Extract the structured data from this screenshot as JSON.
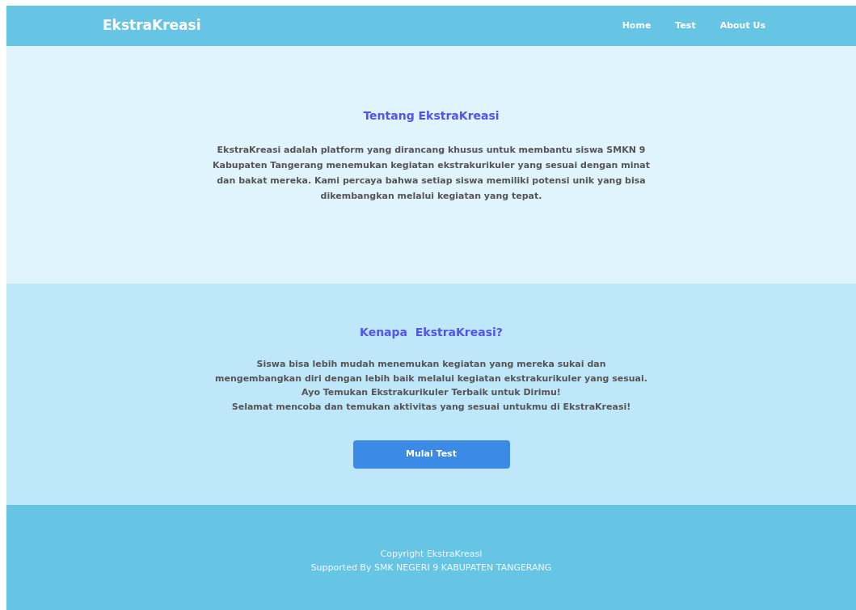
{
  "navbar": {
    "brand": "EkstraKreasi",
    "links": [
      "Home",
      "Test",
      "About Us"
    ]
  },
  "about": {
    "title": "Tentang EkstraKreasi",
    "text": "EkstraKreasi adalah platform yang dirancang khusus untuk membantu siswa SMKN 9 Kabupaten Tangerang menemukan kegiatan ekstrakurikuler yang sesuai dengan minat dan bakat mereka. Kami percaya bahwa setiap siswa memiliki potensi unik yang bisa dikembangkan melalui kegiatan yang tepat."
  },
  "why": {
    "title": "Kenapa  EkstraKreasi?",
    "lines": [
      "Siswa bisa lebih mudah menemukan kegiatan yang mereka sukai dan",
      "mengembangkan diri dengan lebih baik melalui kegiatan ekstrakurikuler yang sesuai.",
      "Ayo Temukan Ekstrakurikuler Terbaik untuk Dirimu!",
      "Selamat mencoba dan temukan aktivitas yang sesuai untukmu di EkstraKreasi!"
    ],
    "button": "Mulai Test"
  },
  "footer": [
    "Copyright EkstraKreasi",
    "Supported By SMK NEGERI 9 KABUPATEN TANGERANG"
  ]
}
